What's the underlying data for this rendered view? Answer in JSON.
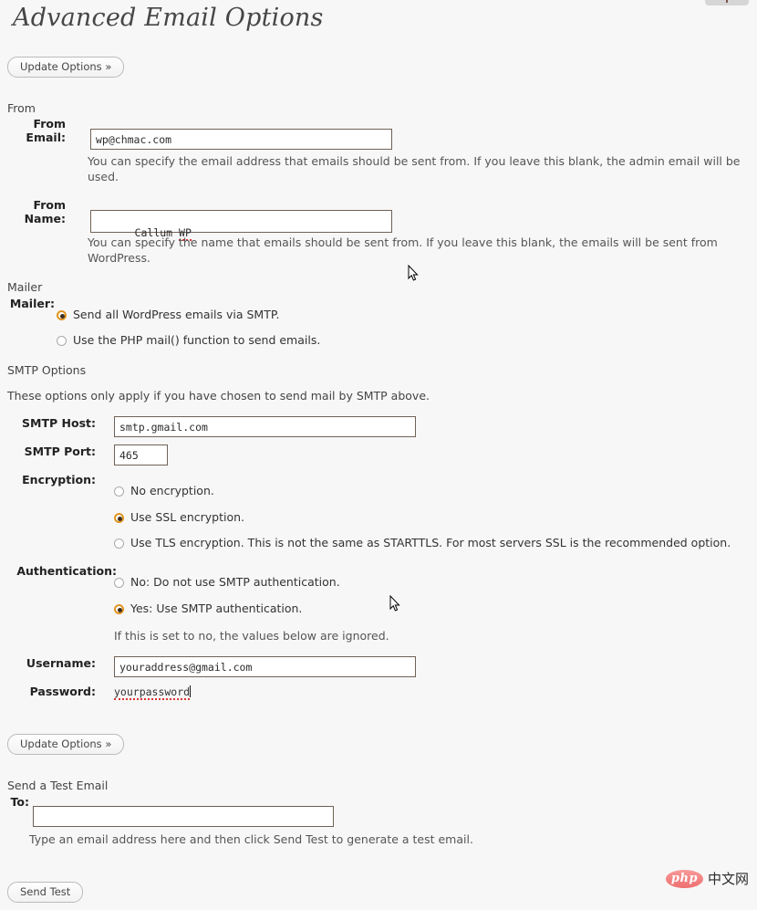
{
  "page": {
    "title": "Advanced Email Options",
    "background": "#f7f7f7"
  },
  "buttons": {
    "update_top": "Update Options »",
    "update_bottom": "Update Options »",
    "send_test": "Send Test"
  },
  "sections": {
    "from": {
      "heading": "From",
      "from_email": {
        "label": "From Email:",
        "value": "wp@chmac.com",
        "description": "You can specify the email address that emails should be sent from. If you leave this blank, the admin email will be used."
      },
      "from_name": {
        "label": "From Name:",
        "value_plain": "Callum ",
        "value_misspelled": "WP",
        "description": "You can specify the name that emails should be sent from. If you leave this blank, the emails will be sent from WordPress."
      }
    },
    "mailer": {
      "heading": "Mailer",
      "label": "Mailer:",
      "options": [
        {
          "label": "Send all WordPress emails via SMTP.",
          "selected": true
        },
        {
          "label": "Use the PHP mail() function to send emails.",
          "selected": false
        }
      ]
    },
    "smtp": {
      "heading": "SMTP Options",
      "note": "These options only apply if you have chosen to send mail by SMTP above.",
      "host": {
        "label": "SMTP Host:",
        "value": "smtp.gmail.com"
      },
      "port": {
        "label": "SMTP Port:",
        "value": "465"
      },
      "encryption": {
        "label": "Encryption:",
        "options": [
          {
            "label": "No encryption.",
            "selected": false
          },
          {
            "label": "Use SSL encryption.",
            "selected": true
          },
          {
            "label": "Use TLS encryption. This is not the same as STARTTLS. For most servers SSL is the recommended option.",
            "selected": false
          }
        ]
      },
      "authentication": {
        "label": "Authentication:",
        "options": [
          {
            "label": "No: Do not use SMTP authentication.",
            "selected": false
          },
          {
            "label": "Yes: Use SMTP authentication.",
            "selected": true
          }
        ],
        "note": "If this is set to no, the values below are ignored."
      },
      "username": {
        "label": "Username:",
        "value": "youraddress@gmail.com"
      },
      "password": {
        "label": "Password:",
        "value": "yourpassword",
        "focused": true
      }
    },
    "test_email": {
      "heading": "Send a Test Email",
      "to": {
        "label": "To:",
        "value": "",
        "placeholder": ""
      },
      "description": "Type an email address here and then click Send Test to generate a test email."
    }
  },
  "watermark": {
    "php": "php",
    "cn": "中文网"
  },
  "colors": {
    "accent_orange": "#e0941f",
    "focus_border": "#e08a33",
    "input_border": "#6f6257",
    "spellcheck_red": "#dd3333"
  }
}
